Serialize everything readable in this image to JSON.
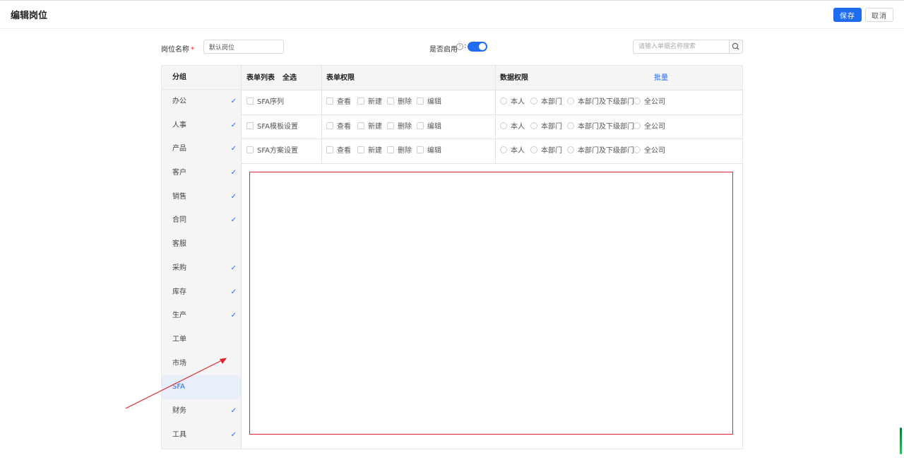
{
  "header": {
    "title": "编辑岗位",
    "save_label": "保存",
    "cancel_label": "取消"
  },
  "form": {
    "name_label": "岗位名称",
    "required_mark": "*",
    "name_value": "默认岗位",
    "enable_label": "是否启用",
    "enable_colon": ":",
    "enabled": true,
    "search_placeholder": "请输入单据名称搜索"
  },
  "sidebar": {
    "header": "分组",
    "items": [
      {
        "label": "办公",
        "checked": true
      },
      {
        "label": "人事",
        "checked": true
      },
      {
        "label": "产品",
        "checked": true
      },
      {
        "label": "客户",
        "checked": true
      },
      {
        "label": "销售",
        "checked": true
      },
      {
        "label": "合同",
        "checked": true
      },
      {
        "label": "客服",
        "checked": false
      },
      {
        "label": "采购",
        "checked": true
      },
      {
        "label": "库存",
        "checked": true
      },
      {
        "label": "生产",
        "checked": true
      },
      {
        "label": "工单",
        "checked": false
      },
      {
        "label": "市场",
        "checked": false
      },
      {
        "label": "SFA",
        "checked": false,
        "active": true
      },
      {
        "label": "财务",
        "checked": true
      },
      {
        "label": "工具",
        "checked": true
      }
    ]
  },
  "table": {
    "col_list": "表单列表",
    "select_all": "全选",
    "col_form_perm": "表单权限",
    "col_data_perm": "数据权限",
    "batch": "批量",
    "rows": [
      {
        "name": "SFA序列",
        "perms": [
          "查看",
          "新建",
          "删除",
          "编辑"
        ],
        "scopes": [
          "本人",
          "本部门",
          "本部门及下级部门",
          "全公司"
        ]
      },
      {
        "name": "SFA模板设置",
        "perms": [
          "查看",
          "新建",
          "删除",
          "编辑"
        ],
        "scopes": [
          "本人",
          "本部门",
          "本部门及下级部门",
          "全公司"
        ]
      },
      {
        "name": "SFA方案设置",
        "perms": [
          "查看",
          "新建",
          "删除",
          "编辑"
        ],
        "scopes": [
          "本人",
          "本部门",
          "本部门及下级部门",
          "全公司"
        ]
      }
    ]
  },
  "colors": {
    "accent": "#1f6cf0",
    "annotation": "#e0242a"
  },
  "icons": {
    "search": "search-icon",
    "help": "help-circle-icon",
    "check": "check-icon"
  }
}
